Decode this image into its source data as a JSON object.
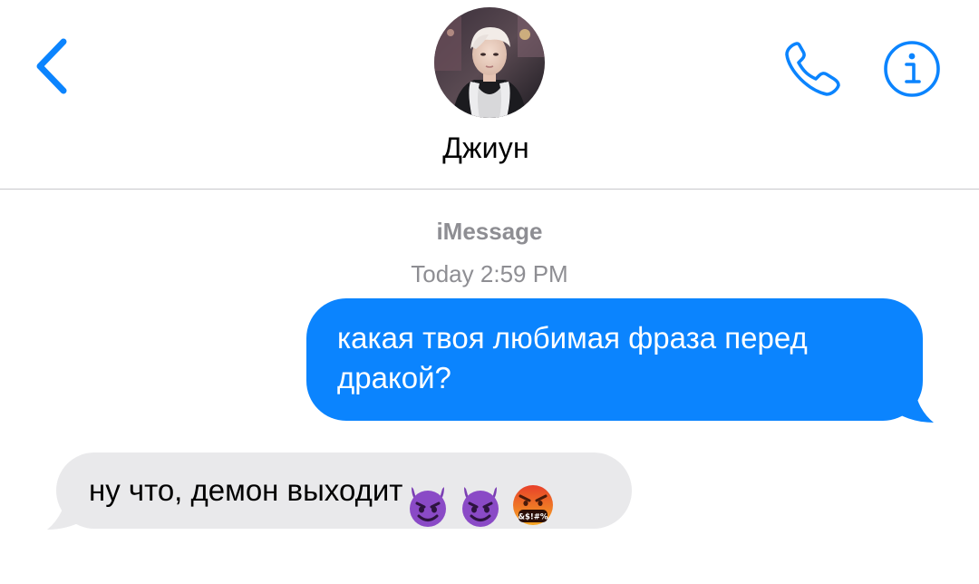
{
  "header": {
    "contact_name": "Джиун",
    "back_icon": "chevron-left-icon",
    "call_icon": "phone-icon",
    "info_icon": "info-icon",
    "accent_color": "#0b84fe"
  },
  "thread": {
    "service_label": "iMessage",
    "timestamp_day": "Today",
    "timestamp_time": "2:59 PM",
    "messages": [
      {
        "direction": "outgoing",
        "text": "какая твоя любимая фраза перед дракой?",
        "bubble_color": "#0b84fe"
      },
      {
        "direction": "incoming",
        "text": "ну что, демон выходит",
        "emoji": [
          "smiling-imp-emoji",
          "smiling-imp-emoji",
          "face-with-symbols-on-mouth-emoji"
        ],
        "emoji_glyph_text": "&$!#%",
        "bubble_color": "#e9e9eb"
      }
    ]
  }
}
